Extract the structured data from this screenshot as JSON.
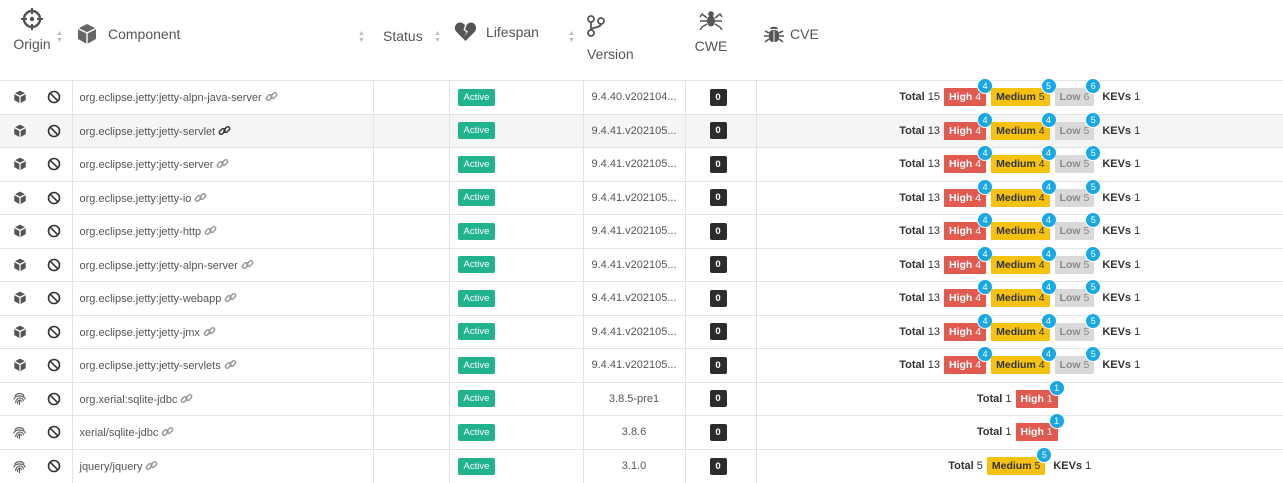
{
  "columns": {
    "origin": "Origin",
    "component": "Component",
    "status": "Status",
    "lifespan": "Lifespan",
    "version": "Version",
    "cwe": "CWE",
    "cve": "CVE"
  },
  "labels": {
    "total": "Total",
    "high": "High",
    "medium": "Medium",
    "low": "Low",
    "kevs": "KEVs"
  },
  "rows": [
    {
      "origin": "package",
      "name": "org.eclipse.jetty:jetty-alpn-java-server",
      "lifespan": "Active",
      "version": "9.4.40.v202104...",
      "cwe": "0",
      "total": "15",
      "high": "4",
      "high_badge": "4",
      "medium": "5",
      "medium_badge": "5",
      "low": "6",
      "low_badge": "6",
      "kevs": "1"
    },
    {
      "origin": "package",
      "name": "org.eclipse.jetty:jetty-servlet",
      "lifespan": "Active",
      "version": "9.4.41.v202105...",
      "cwe": "0",
      "total": "13",
      "high": "4",
      "high_badge": "4",
      "medium": "4",
      "medium_badge": "4",
      "low": "5",
      "low_badge": "5",
      "kevs": "1",
      "highlight": true
    },
    {
      "origin": "package",
      "name": "org.eclipse.jetty:jetty-server",
      "lifespan": "Active",
      "version": "9.4.41.v202105...",
      "cwe": "0",
      "total": "13",
      "high": "4",
      "high_badge": "4",
      "medium": "4",
      "medium_badge": "4",
      "low": "5",
      "low_badge": "5",
      "kevs": "1"
    },
    {
      "origin": "package",
      "name": "org.eclipse.jetty:jetty-io",
      "lifespan": "Active",
      "version": "9.4.41.v202105...",
      "cwe": "0",
      "total": "13",
      "high": "4",
      "high_badge": "4",
      "medium": "4",
      "medium_badge": "4",
      "low": "5",
      "low_badge": "5",
      "kevs": "1"
    },
    {
      "origin": "package",
      "name": "org.eclipse.jetty:jetty-http",
      "lifespan": "Active",
      "version": "9.4.41.v202105...",
      "cwe": "0",
      "total": "13",
      "high": "4",
      "high_badge": "4",
      "medium": "4",
      "medium_badge": "4",
      "low": "5",
      "low_badge": "5",
      "kevs": "1"
    },
    {
      "origin": "package",
      "name": "org.eclipse.jetty:jetty-alpn-server",
      "lifespan": "Active",
      "version": "9.4.41.v202105...",
      "cwe": "0",
      "total": "13",
      "high": "4",
      "high_badge": "4",
      "medium": "4",
      "medium_badge": "4",
      "low": "5",
      "low_badge": "5",
      "kevs": "1"
    },
    {
      "origin": "package",
      "name": "org.eclipse.jetty:jetty-webapp",
      "lifespan": "Active",
      "version": "9.4.41.v202105...",
      "cwe": "0",
      "total": "13",
      "high": "4",
      "high_badge": "4",
      "medium": "4",
      "medium_badge": "4",
      "low": "5",
      "low_badge": "5",
      "kevs": "1"
    },
    {
      "origin": "package",
      "name": "org.eclipse.jetty:jetty-jmx",
      "lifespan": "Active",
      "version": "9.4.41.v202105...",
      "cwe": "0",
      "total": "13",
      "high": "4",
      "high_badge": "4",
      "medium": "4",
      "medium_badge": "4",
      "low": "5",
      "low_badge": "5",
      "kevs": "1"
    },
    {
      "origin": "package",
      "name": "org.eclipse.jetty:jetty-servlets",
      "lifespan": "Active",
      "version": "9.4.41.v202105...",
      "cwe": "0",
      "total": "13",
      "high": "4",
      "high_badge": "4",
      "medium": "4",
      "medium_badge": "4",
      "low": "5",
      "low_badge": "5",
      "kevs": "1"
    },
    {
      "origin": "fingerprint",
      "name": "org.xerial:sqlite-jdbc",
      "lifespan": "Active",
      "version": "3.8.5-pre1",
      "cwe": "0",
      "total": "1",
      "high": "1",
      "high_badge": "1"
    },
    {
      "origin": "fingerprint",
      "name": "xerial/sqlite-jdbc",
      "lifespan": "Active",
      "version": "3.8.6",
      "cwe": "0",
      "total": "1",
      "high": "1",
      "high_badge": "1"
    },
    {
      "origin": "fingerprint",
      "name": "jquery/jquery",
      "lifespan": "Active",
      "version": "3.1.0",
      "cwe": "0",
      "total": "5",
      "medium": "5",
      "medium_badge": "5",
      "kevs": "1"
    }
  ],
  "colors": {
    "active": "#20b38c",
    "high": "#e05a50",
    "medium": "#f5c211",
    "low": "#d9d9d9",
    "count_bubble": "#18a8e6",
    "cwe_badge": "#2c2c2c"
  }
}
